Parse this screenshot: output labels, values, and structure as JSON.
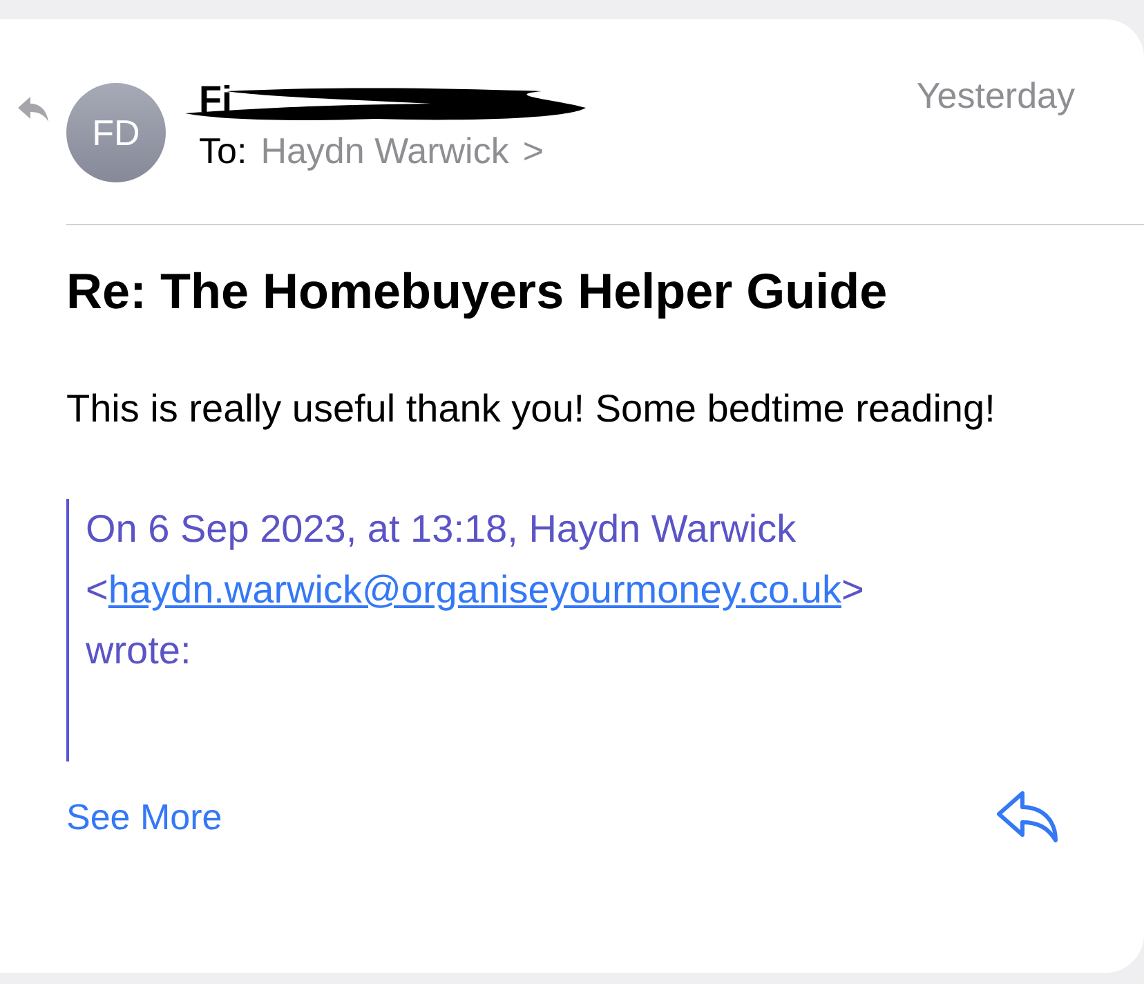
{
  "message": {
    "avatar_initials": "FD",
    "sender": "Fi",
    "to_label": "To:",
    "recipient": "Haydn Warwick",
    "recipient_chevron": ">",
    "date": "Yesterday",
    "subject": "Re: The Homebuyers Helper Guide",
    "body": "This is really useful thank you! Some bedtime reading!",
    "quote": {
      "intro": "On 6 Sep 2023, at 13:18, Haydn Warwick",
      "email_open": "<",
      "email": "haydn.warwick@organiseyourmoney.co.uk",
      "email_close": ">",
      "wrote": "wrote:"
    },
    "see_more": "See More",
    "replied": true
  }
}
